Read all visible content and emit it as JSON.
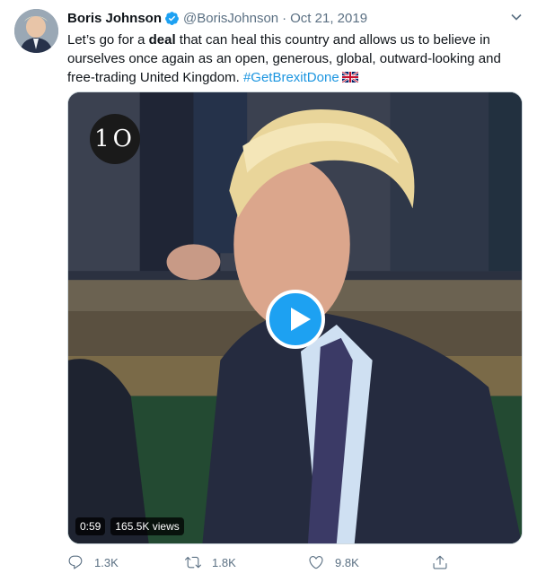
{
  "tweet": {
    "author_name": "Boris Johnson",
    "handle": "@BorisJohnson",
    "separator": "·",
    "date": "Oct 21, 2019",
    "text_before": "Let’s go for a ",
    "text_bold": "deal",
    "text_after": " that can heal this country and allows us to believe in ourselves once again as an open, generous, global, outward-looking and free-trading United Kingdom. ",
    "hashtag": "#GetBrexitDone",
    "icons": {
      "verified": "verified-badge-icon",
      "menu": "chevron-down-icon",
      "flag": "uk-flag-emoji"
    }
  },
  "video": {
    "channel_badge": "1O",
    "duration": "0:59",
    "views": "165.5K views",
    "play_icon": "play-icon"
  },
  "actions": {
    "reply_count": "1.3K",
    "retweet_count": "1.8K",
    "like_count": "9.8K",
    "icons": [
      "reply-icon",
      "retweet-icon",
      "like-icon",
      "share-icon"
    ]
  },
  "colors": {
    "accent": "#1da1f2",
    "hashtag": "#1b95e0",
    "muted": "#5b7083"
  }
}
